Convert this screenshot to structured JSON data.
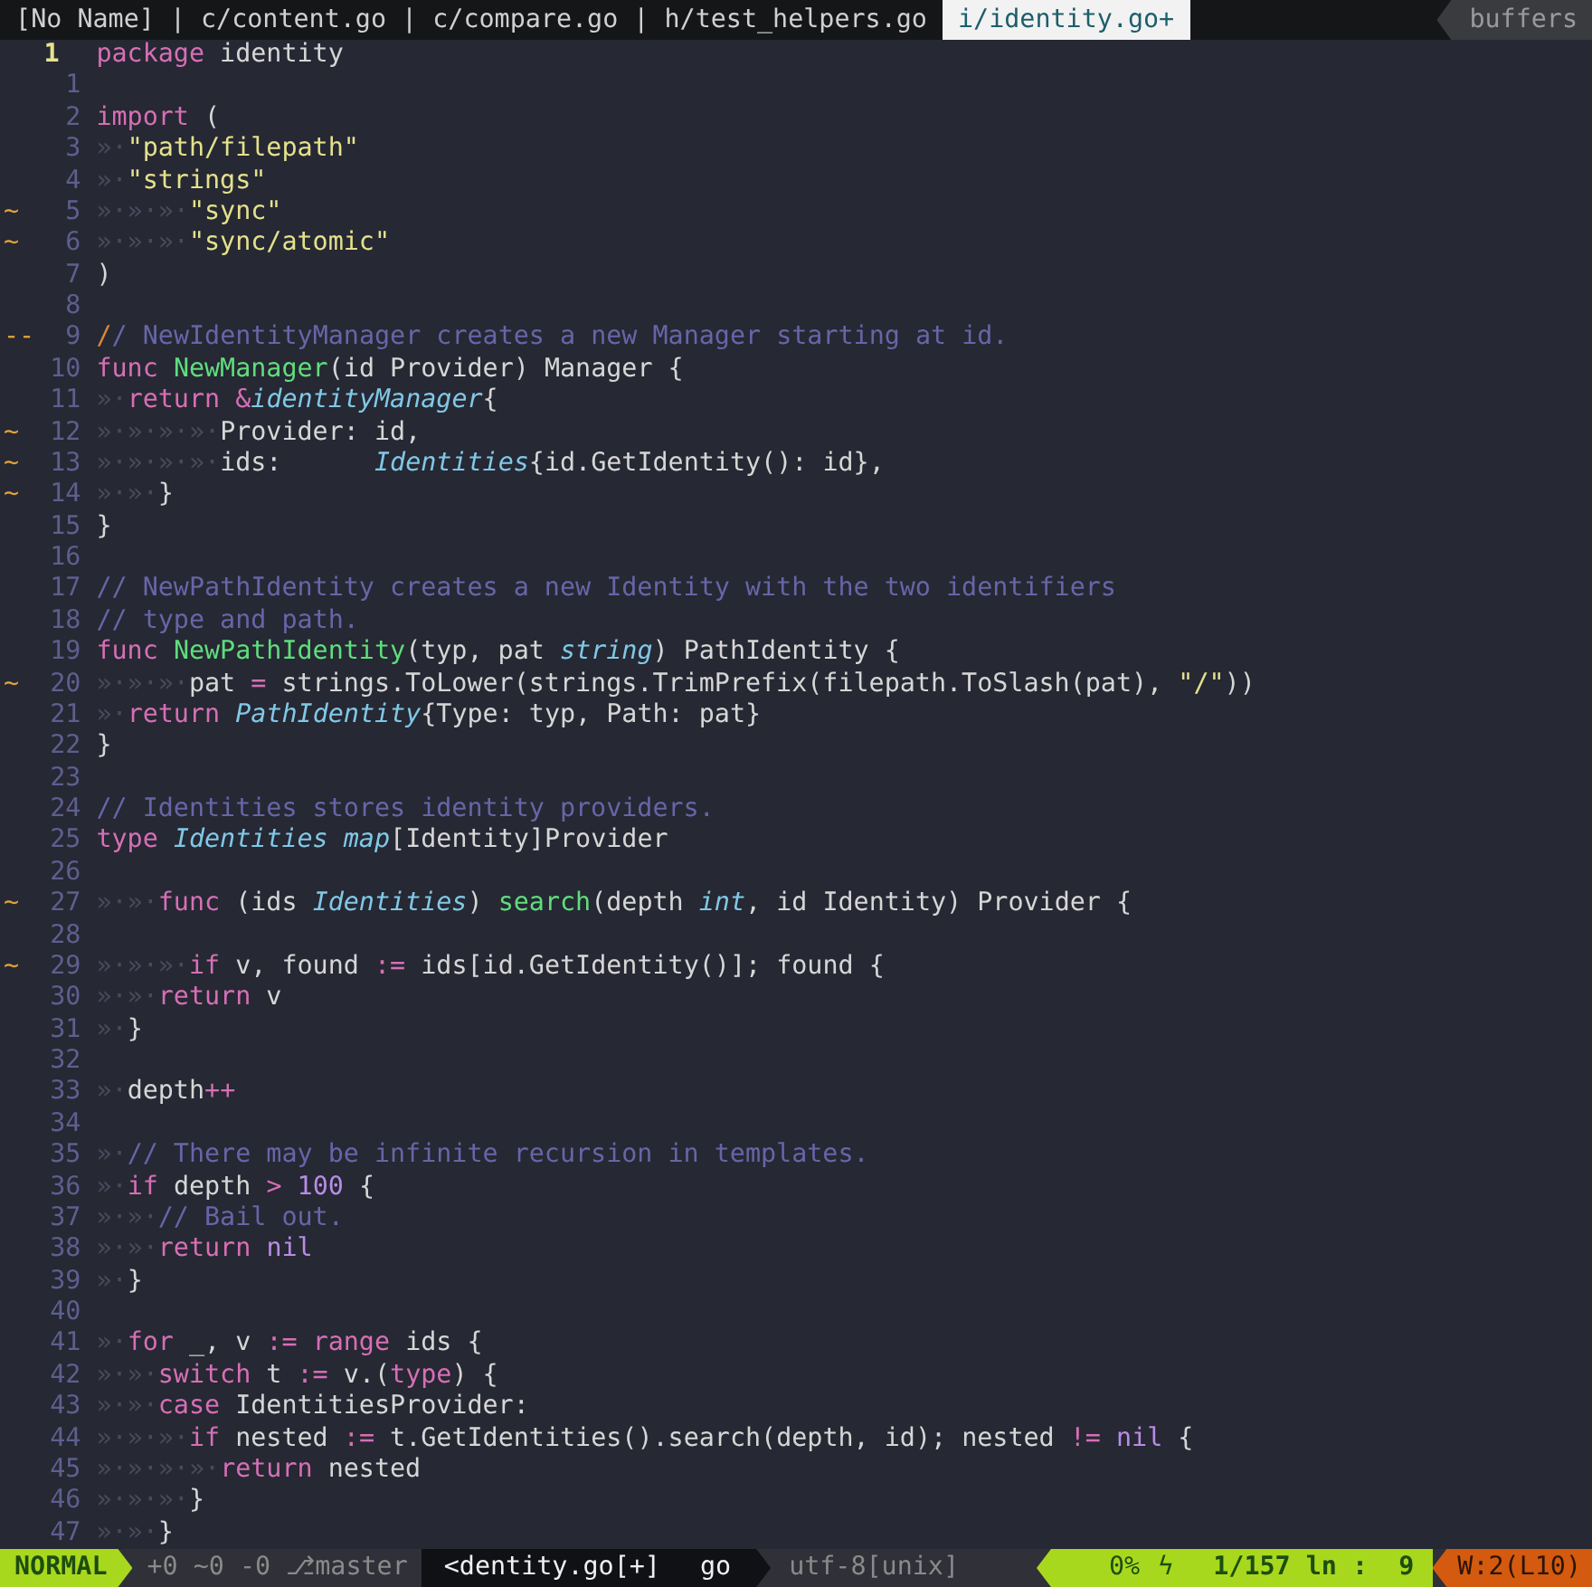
{
  "tabline": {
    "items": [
      {
        "kind": "tab",
        "label": "[No Name]",
        "selected": false
      },
      {
        "kind": "separator",
        "label": "|"
      },
      {
        "kind": "tab",
        "label": "c/content.go",
        "selected": false
      },
      {
        "kind": "separator",
        "label": "|"
      },
      {
        "kind": "tab",
        "label": "c/compare.go",
        "selected": false
      },
      {
        "kind": "separator",
        "label": "|"
      },
      {
        "kind": "tab",
        "label": "h/test_helpers.go",
        "selected": false
      },
      {
        "kind": "tab",
        "label": "i/identity.go+",
        "selected": true
      }
    ],
    "buffers_label": "buffers"
  },
  "lines": [
    {
      "number": "1",
      "current": true,
      "tokens": [
        {
          "kind": "kw",
          "text": "package"
        },
        {
          "kind": "plain",
          "text": " identity"
        }
      ]
    },
    {
      "number": "1",
      "current": false
    },
    {
      "number": "2",
      "current": false,
      "tokens": [
        {
          "kind": "kw",
          "text": "import"
        },
        {
          "kind": "plain",
          "text": " ("
        }
      ]
    },
    {
      "number": "3",
      "current": false,
      "tokens": [
        {
          "kind": "ws",
          "text": "»·"
        },
        {
          "kind": "str",
          "text": "\"path/filepath\""
        }
      ]
    },
    {
      "number": "4",
      "current": false,
      "tokens": [
        {
          "kind": "ws",
          "text": "»·"
        },
        {
          "kind": "str",
          "text": "\"strings\""
        }
      ]
    },
    {
      "number": "5",
      "current": false,
      "sign": "~",
      "tokens": [
        {
          "kind": "ws",
          "text": "»·»·»·"
        },
        {
          "kind": "str",
          "text": "\"sync\""
        }
      ]
    },
    {
      "number": "6",
      "current": false,
      "sign": "~",
      "tokens": [
        {
          "kind": "ws",
          "text": "»·»·»·"
        },
        {
          "kind": "str",
          "text": "\"sync/atomic\""
        }
      ]
    },
    {
      "number": "7",
      "current": false,
      "tokens": [
        {
          "kind": "plain",
          "text": ")"
        }
      ]
    },
    {
      "number": "8",
      "current": false
    },
    {
      "number": "9",
      "current": false,
      "sign": "--",
      "tokens": [
        {
          "kind": "mark",
          "text": "/"
        },
        {
          "kind": "com",
          "text": "/ NewIdentityManager creates a new Manager starting at id."
        }
      ]
    },
    {
      "number": "10",
      "current": false,
      "tokens": [
        {
          "kind": "kw",
          "text": "func "
        },
        {
          "kind": "fn",
          "text": "NewManager"
        },
        {
          "kind": "plain",
          "text": "(id Provider) Manager {"
        }
      ]
    },
    {
      "number": "11",
      "current": false,
      "tokens": [
        {
          "kind": "ws",
          "text": "»·"
        },
        {
          "kind": "kw",
          "text": "return "
        },
        {
          "kind": "op",
          "text": "&"
        },
        {
          "kind": "type",
          "text": "identityManager"
        },
        {
          "kind": "plain",
          "text": "{"
        }
      ]
    },
    {
      "number": "12",
      "current": false,
      "sign": "~",
      "tokens": [
        {
          "kind": "ws",
          "text": "»·»·»·»·"
        },
        {
          "kind": "plain",
          "text": "Provider: id,"
        }
      ]
    },
    {
      "number": "13",
      "current": false,
      "sign": "~",
      "tokens": [
        {
          "kind": "ws",
          "text": "»·»·»·»·"
        },
        {
          "kind": "plain",
          "text": "ids:      "
        },
        {
          "kind": "type",
          "text": "Identities"
        },
        {
          "kind": "plain",
          "text": "{id.GetIdentity(): id},"
        }
      ]
    },
    {
      "number": "14",
      "current": false,
      "sign": "~",
      "tokens": [
        {
          "kind": "ws",
          "text": "»·»·"
        },
        {
          "kind": "plain",
          "text": "}"
        }
      ]
    },
    {
      "number": "15",
      "current": false,
      "tokens": [
        {
          "kind": "plain",
          "text": "}"
        }
      ]
    },
    {
      "number": "16",
      "current": false
    },
    {
      "number": "17",
      "current": false,
      "tokens": [
        {
          "kind": "com",
          "text": "// NewPathIdentity creates a new Identity with the two identifiers"
        }
      ]
    },
    {
      "number": "18",
      "current": false,
      "tokens": [
        {
          "kind": "com",
          "text": "// type and path."
        }
      ]
    },
    {
      "number": "19",
      "current": false,
      "tokens": [
        {
          "kind": "kw",
          "text": "func "
        },
        {
          "kind": "fn",
          "text": "NewPathIdentity"
        },
        {
          "kind": "plain",
          "text": "(typ, pat "
        },
        {
          "kind": "type",
          "text": "string"
        },
        {
          "kind": "plain",
          "text": ") PathIdentity {"
        }
      ]
    },
    {
      "number": "20",
      "current": false,
      "sign": "~",
      "tokens": [
        {
          "kind": "ws",
          "text": "»·»·»·"
        },
        {
          "kind": "plain",
          "text": "pat "
        },
        {
          "kind": "op",
          "text": "="
        },
        {
          "kind": "plain",
          "text": " strings.ToLower(strings.TrimPrefix(filepath.ToSlash(pat), "
        },
        {
          "kind": "str",
          "text": "\"/\""
        },
        {
          "kind": "plain",
          "text": "))"
        }
      ]
    },
    {
      "number": "21",
      "current": false,
      "tokens": [
        {
          "kind": "ws",
          "text": "»·"
        },
        {
          "kind": "kw",
          "text": "return "
        },
        {
          "kind": "type",
          "text": "PathIdentity"
        },
        {
          "kind": "plain",
          "text": "{Type: typ, Path: pat}"
        }
      ]
    },
    {
      "number": "22",
      "current": false,
      "tokens": [
        {
          "kind": "plain",
          "text": "}"
        }
      ]
    },
    {
      "number": "23",
      "current": false
    },
    {
      "number": "24",
      "current": false,
      "tokens": [
        {
          "kind": "com",
          "text": "// Identities stores identity providers."
        }
      ]
    },
    {
      "number": "25",
      "current": false,
      "tokens": [
        {
          "kind": "kw",
          "text": "type "
        },
        {
          "kind": "type",
          "text": "Identities map"
        },
        {
          "kind": "plain",
          "text": "[Identity]Provider"
        }
      ]
    },
    {
      "number": "26",
      "current": false
    },
    {
      "number": "27",
      "current": false,
      "sign": "~",
      "tokens": [
        {
          "kind": "ws",
          "text": "»·»·"
        },
        {
          "kind": "kw",
          "text": "func"
        },
        {
          "kind": "plain",
          "text": " (ids "
        },
        {
          "kind": "type",
          "text": "Identities"
        },
        {
          "kind": "plain",
          "text": ") "
        },
        {
          "kind": "fn",
          "text": "search"
        },
        {
          "kind": "plain",
          "text": "(depth "
        },
        {
          "kind": "type",
          "text": "int"
        },
        {
          "kind": "plain",
          "text": ", id Identity) Provider {"
        }
      ]
    },
    {
      "number": "28",
      "current": false
    },
    {
      "number": "29",
      "current": false,
      "sign": "~",
      "tokens": [
        {
          "kind": "ws",
          "text": "»·»·»·"
        },
        {
          "kind": "kw",
          "text": "if"
        },
        {
          "kind": "plain",
          "text": " v, found "
        },
        {
          "kind": "op",
          "text": ":="
        },
        {
          "kind": "plain",
          "text": " ids[id.GetIdentity()]; found {"
        }
      ]
    },
    {
      "number": "30",
      "current": false,
      "tokens": [
        {
          "kind": "ws",
          "text": "»·»·"
        },
        {
          "kind": "kw",
          "text": "return"
        },
        {
          "kind": "plain",
          "text": " v"
        }
      ]
    },
    {
      "number": "31",
      "current": false,
      "tokens": [
        {
          "kind": "ws",
          "text": "»·"
        },
        {
          "kind": "plain",
          "text": "}"
        }
      ]
    },
    {
      "number": "32",
      "current": false
    },
    {
      "number": "33",
      "current": false,
      "tokens": [
        {
          "kind": "ws",
          "text": "»·"
        },
        {
          "kind": "plain",
          "text": "depth"
        },
        {
          "kind": "op",
          "text": "++"
        }
      ]
    },
    {
      "number": "34",
      "current": false
    },
    {
      "number": "35",
      "current": false,
      "tokens": [
        {
          "kind": "ws",
          "text": "»·"
        },
        {
          "kind": "com",
          "text": "// There may be infinite recursion in templates."
        }
      ]
    },
    {
      "number": "36",
      "current": false,
      "tokens": [
        {
          "kind": "ws",
          "text": "»·"
        },
        {
          "kind": "kw",
          "text": "if"
        },
        {
          "kind": "plain",
          "text": " depth "
        },
        {
          "kind": "op",
          "text": "> "
        },
        {
          "kind": "num",
          "text": "100"
        },
        {
          "kind": "plain",
          "text": " {"
        }
      ]
    },
    {
      "number": "37",
      "current": false,
      "tokens": [
        {
          "kind": "ws",
          "text": "»·»·"
        },
        {
          "kind": "com",
          "text": "// Bail out."
        }
      ]
    },
    {
      "number": "38",
      "current": false,
      "tokens": [
        {
          "kind": "ws",
          "text": "»·»·"
        },
        {
          "kind": "kw",
          "text": "return "
        },
        {
          "kind": "num",
          "text": "nil"
        }
      ]
    },
    {
      "number": "39",
      "current": false,
      "tokens": [
        {
          "kind": "ws",
          "text": "»·"
        },
        {
          "kind": "plain",
          "text": "}"
        }
      ]
    },
    {
      "number": "40",
      "current": false
    },
    {
      "number": "41",
      "current": false,
      "tokens": [
        {
          "kind": "ws",
          "text": "»·"
        },
        {
          "kind": "kw",
          "text": "for"
        },
        {
          "kind": "plain",
          "text": " _, v "
        },
        {
          "kind": "op",
          "text": ":= "
        },
        {
          "kind": "kw",
          "text": "range"
        },
        {
          "kind": "plain",
          "text": " ids {"
        }
      ]
    },
    {
      "number": "42",
      "current": false,
      "tokens": [
        {
          "kind": "ws",
          "text": "»·»·"
        },
        {
          "kind": "kw",
          "text": "switch"
        },
        {
          "kind": "plain",
          "text": " t "
        },
        {
          "kind": "op",
          "text": ":="
        },
        {
          "kind": "plain",
          "text": " v.("
        },
        {
          "kind": "kw",
          "text": "type"
        },
        {
          "kind": "plain",
          "text": ") {"
        }
      ]
    },
    {
      "number": "43",
      "current": false,
      "tokens": [
        {
          "kind": "ws",
          "text": "»·»·"
        },
        {
          "kind": "kw",
          "text": "case"
        },
        {
          "kind": "plain",
          "text": " IdentitiesProvider:"
        }
      ]
    },
    {
      "number": "44",
      "current": false,
      "tokens": [
        {
          "kind": "ws",
          "text": "»·»·»·"
        },
        {
          "kind": "kw",
          "text": "if"
        },
        {
          "kind": "plain",
          "text": " nested "
        },
        {
          "kind": "op",
          "text": ":="
        },
        {
          "kind": "plain",
          "text": " t.GetIdentities().search(depth, id); nested "
        },
        {
          "kind": "op",
          "text": "!= "
        },
        {
          "kind": "num",
          "text": "nil"
        },
        {
          "kind": "plain",
          "text": " {"
        }
      ]
    },
    {
      "number": "45",
      "current": false,
      "tokens": [
        {
          "kind": "ws",
          "text": "»·»·»·»·"
        },
        {
          "kind": "kw",
          "text": "return"
        },
        {
          "kind": "plain",
          "text": " nested"
        }
      ]
    },
    {
      "number": "46",
      "current": false,
      "tokens": [
        {
          "kind": "ws",
          "text": "»·»·»·"
        },
        {
          "kind": "plain",
          "text": "}"
        }
      ]
    },
    {
      "number": "47",
      "current": false,
      "tokens": [
        {
          "kind": "ws",
          "text": "»·»·"
        },
        {
          "kind": "plain",
          "text": "}"
        }
      ]
    }
  ],
  "status_bar": {
    "segments": [
      {
        "kind": "mode",
        "text": "NORMAL"
      },
      {
        "kind": "git",
        "text": "+0 ~0 -0 ⎇master"
      },
      {
        "kind": "file",
        "text": "<dentity.go[+]"
      },
      {
        "kind": "filetype",
        "text": "go"
      },
      {
        "kind": "encoding",
        "text": "utf-8[unix]"
      },
      {
        "kind": "percent",
        "text": "0%"
      },
      {
        "kind": "symbol",
        "text": "ϟ"
      },
      {
        "kind": "position",
        "text": "1/157 ln :  9"
      },
      {
        "kind": "warning",
        "text": "W:2(L10)"
      }
    ]
  }
}
